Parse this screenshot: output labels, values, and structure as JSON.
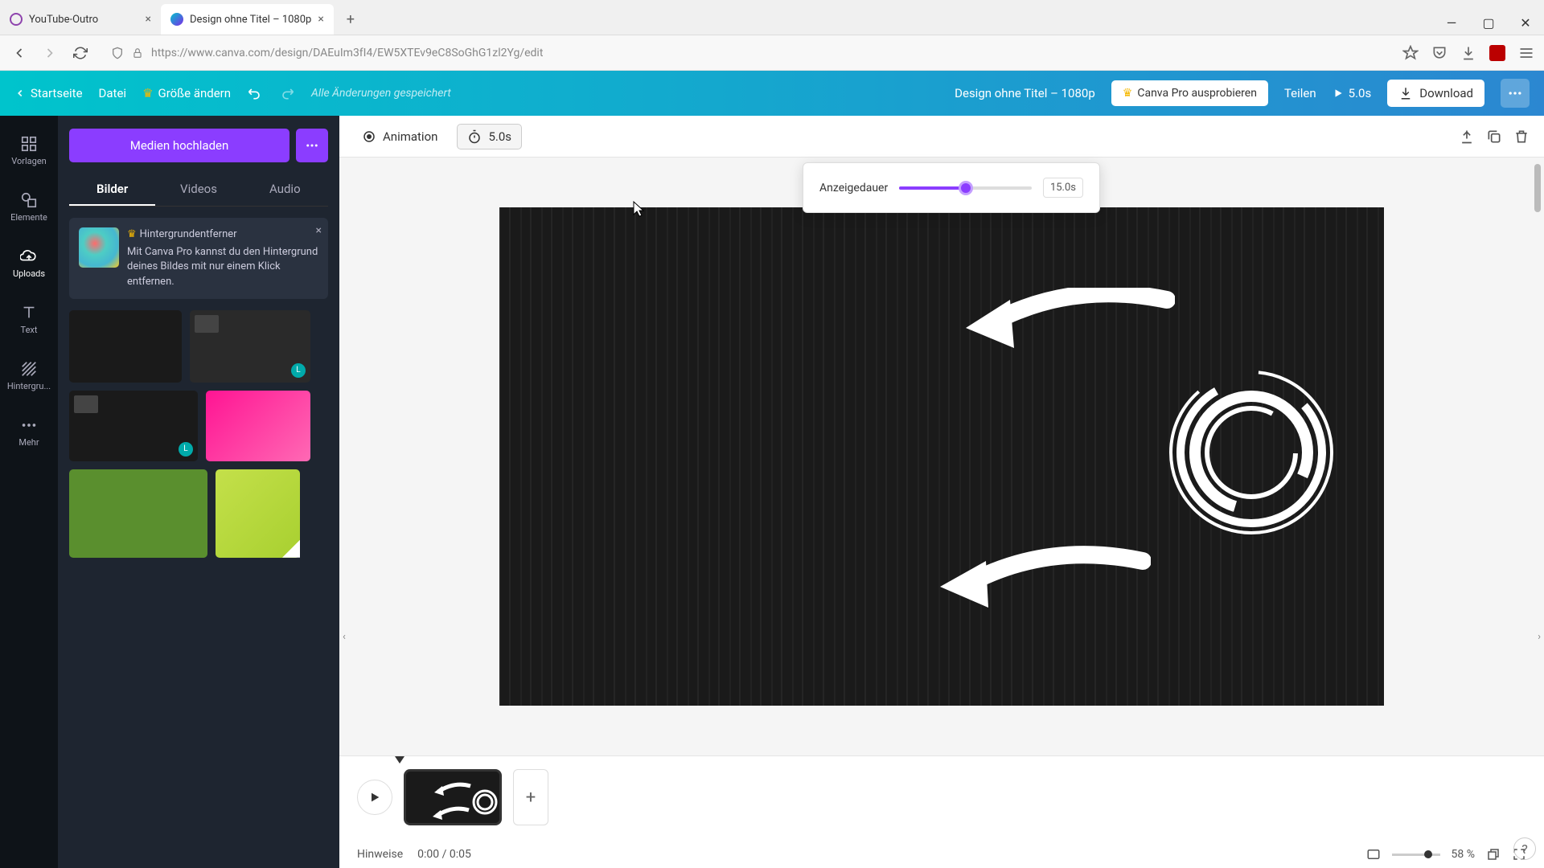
{
  "browser": {
    "tabs": [
      {
        "title": "YouTube-Outro",
        "favicon": "yt"
      },
      {
        "title": "Design ohne Titel – 1080p",
        "favicon": "canva"
      }
    ],
    "url": "https://www.canva.com/design/DAEuIm3fI4/EW5XTEv9eC8SoGhG1zl2Yg/edit"
  },
  "topbar": {
    "home": "Startseite",
    "file": "Datei",
    "resize": "Größe ändern",
    "saved": "Alle Änderungen gespeichert",
    "doc_title": "Design ohne Titel – 1080p",
    "pro": "Canva Pro ausprobieren",
    "share": "Teilen",
    "play_duration": "5.0s",
    "download": "Download"
  },
  "rail": {
    "items": [
      "Vorlagen",
      "Elemente",
      "Uploads",
      "Text",
      "Hintergru...",
      "Mehr"
    ],
    "active_index": 2
  },
  "panel": {
    "upload": "Medien hochladen",
    "tabs": [
      "Bilder",
      "Videos",
      "Audio"
    ],
    "active_tab": 0,
    "promo": {
      "title": "Hintergrundentferner",
      "body": "Mit Canva Pro kannst du den Hintergrund deines Bildes mit nur einem Klick entfernen."
    }
  },
  "toolbar": {
    "animation": "Animation",
    "duration": "5.0s"
  },
  "popover": {
    "label": "Anzeigedauer",
    "value": "15.0s"
  },
  "timeline": {
    "hints": "Hinweise",
    "time": "0:00 / 0:05",
    "zoom": "58 %"
  }
}
